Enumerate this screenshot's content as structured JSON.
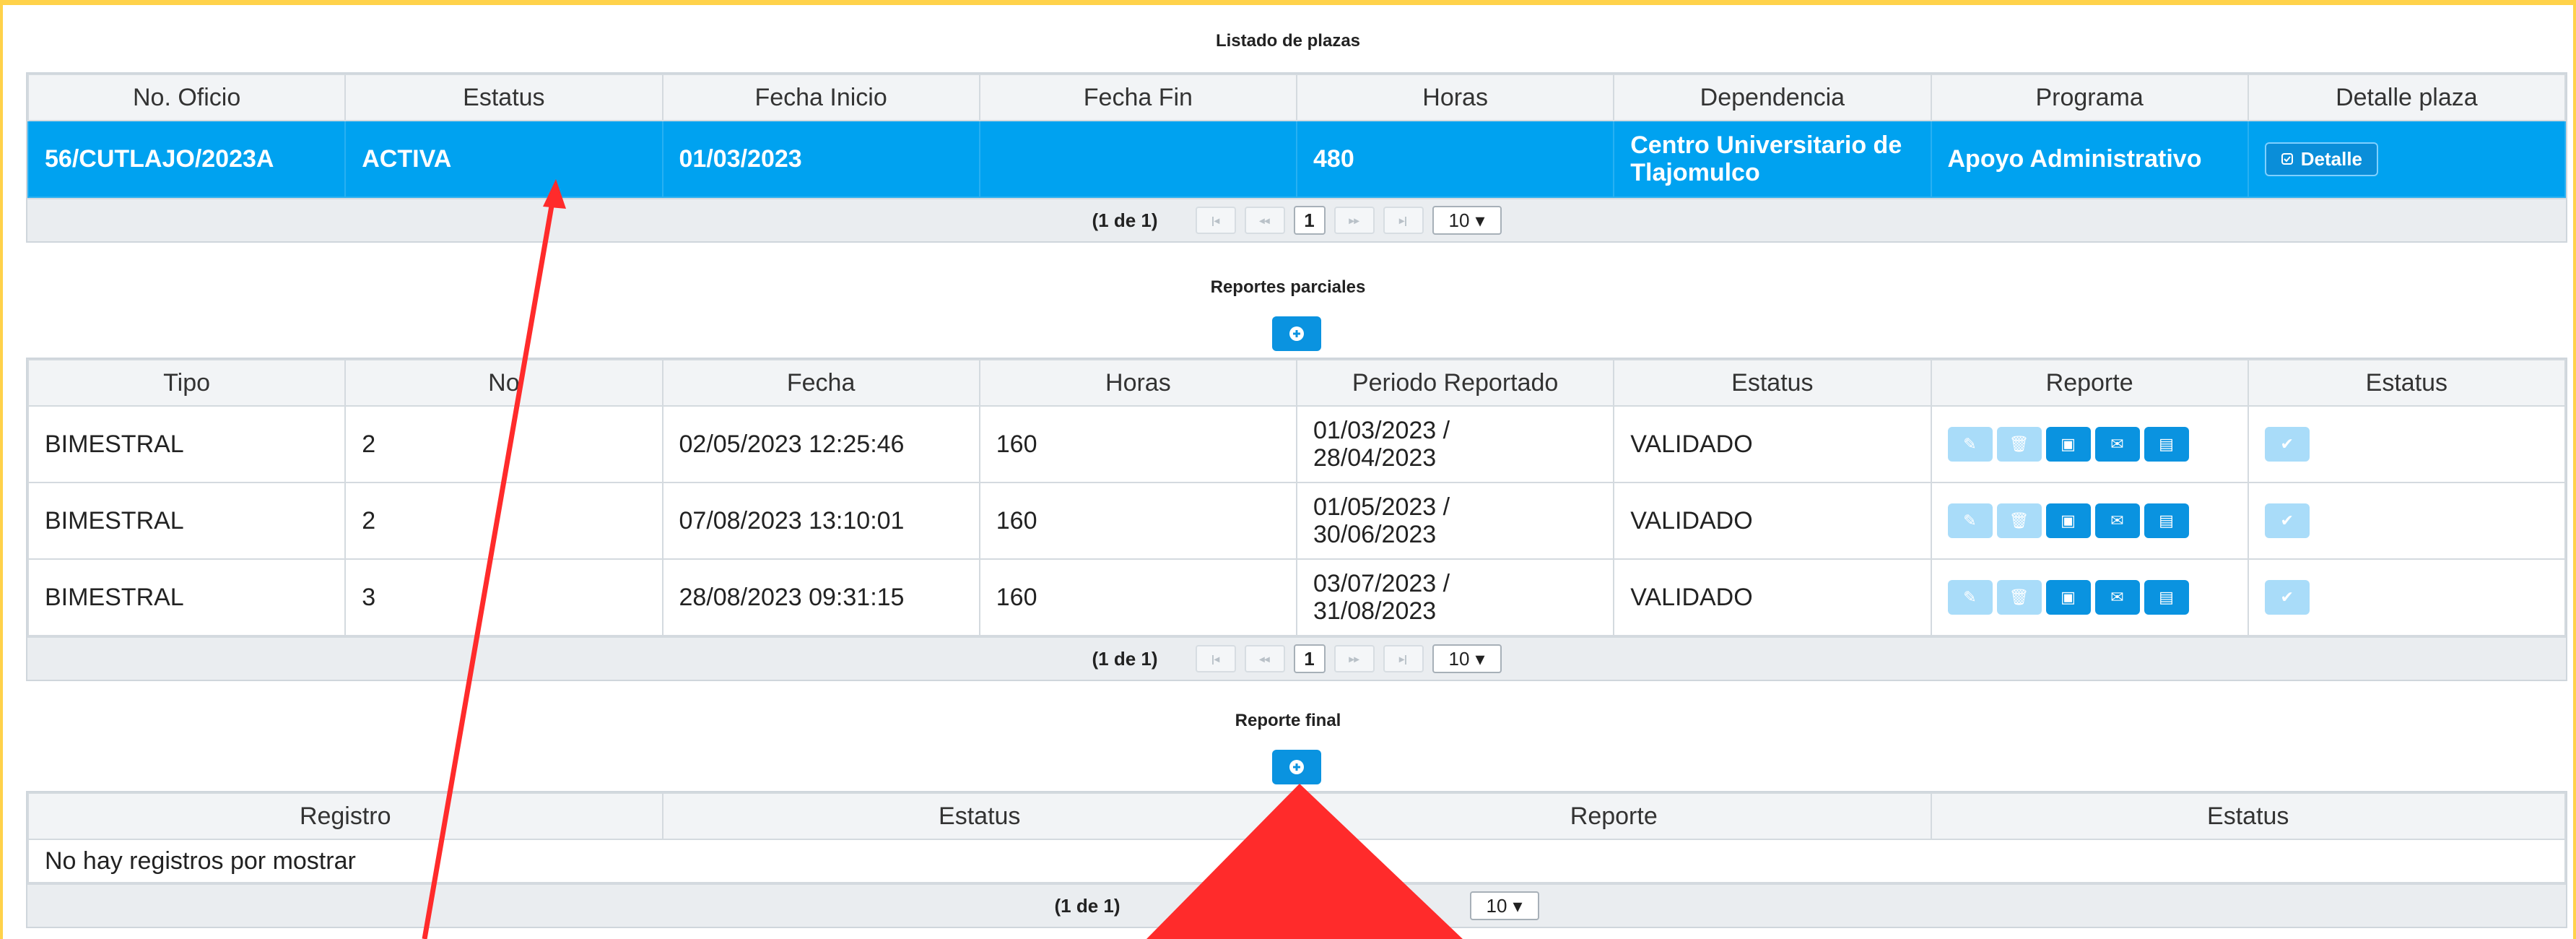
{
  "colors": {
    "selected_row": "#00a2f0",
    "button": "#0a93e0",
    "button_disabled": "#a9dcf9",
    "frame": "#ffd24a",
    "annotation": "#ff2b2b"
  },
  "plazas": {
    "title": "Listado de plazas",
    "headers": [
      "No. Oficio",
      "Estatus",
      "Fecha Inicio",
      "Fecha Fin",
      "Horas",
      "Dependencia",
      "Programa",
      "Detalle plaza"
    ],
    "row": {
      "oficio": "56/CUTLAJO/2023A",
      "estatus": "ACTIVA",
      "fecha_inicio": "01/03/2023",
      "fecha_fin": "",
      "horas": "480",
      "dependencia_1": "Centro Universitario de",
      "dependencia_2": "Tlajomulco",
      "programa": "Apoyo Administrativo",
      "detalle_label": "Detalle"
    },
    "pager": {
      "summary": "(1 de 1)",
      "page": "1",
      "rows_per_page": "10"
    }
  },
  "parciales": {
    "title": "Reportes parciales",
    "headers": [
      "Tipo",
      "No",
      "Fecha",
      "Horas",
      "Periodo Reportado",
      "Estatus",
      "Reporte",
      "Estatus"
    ],
    "rows": [
      {
        "tipo": "BIMESTRAL",
        "no": "2",
        "fecha": "02/05/2023 12:25:46",
        "horas": "160",
        "periodo_1": "01/03/2023 /",
        "periodo_2": "28/04/2023",
        "estatus": "VALIDADO"
      },
      {
        "tipo": "BIMESTRAL",
        "no": "2",
        "fecha": "07/08/2023 13:10:01",
        "horas": "160",
        "periodo_1": "01/05/2023 /",
        "periodo_2": "30/06/2023",
        "estatus": "VALIDADO"
      },
      {
        "tipo": "BIMESTRAL",
        "no": "3",
        "fecha": "28/08/2023 09:31:15",
        "horas": "160",
        "periodo_1": "03/07/2023 /",
        "periodo_2": "31/08/2023",
        "estatus": "VALIDADO"
      }
    ],
    "row_icons": [
      "pencil-icon",
      "trash-icon",
      "view-icon",
      "comment-icon",
      "save-icon",
      "check-icon"
    ],
    "pager": {
      "summary": "(1 de 1)",
      "page": "1",
      "rows_per_page": "10"
    }
  },
  "final": {
    "title": "Reporte final",
    "headers": [
      "Registro",
      "Estatus",
      "Reporte",
      "Estatus"
    ],
    "empty_message": "No hay registros por mostrar",
    "pager": {
      "summary": "(1 de 1)",
      "rows_per_page": "10"
    }
  }
}
